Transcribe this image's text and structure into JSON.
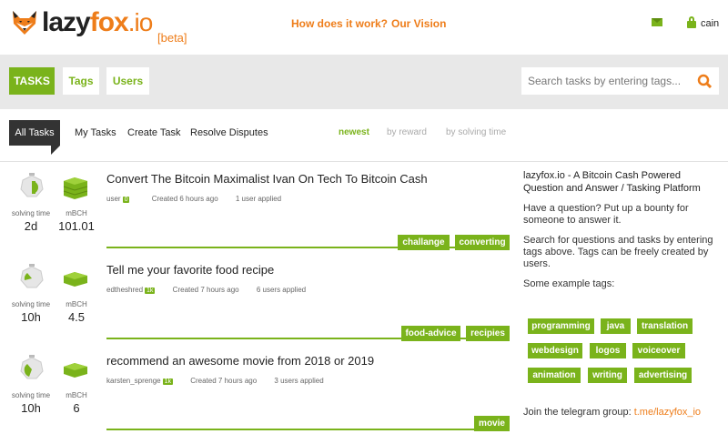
{
  "header": {
    "brand_prefix": "lazy",
    "brand_accent": "fox",
    "brand_io": ".io",
    "beta": "[beta]",
    "nav": [
      {
        "label": "How does it work?"
      },
      {
        "label": "Our Vision"
      }
    ],
    "user": "cain"
  },
  "toolbar": {
    "tabs": [
      {
        "label": "TASKS",
        "active": true
      },
      {
        "label": "Tags",
        "active": false
      },
      {
        "label": "Users",
        "active": false
      }
    ],
    "search_placeholder": "Search tasks by entering tags..."
  },
  "subnav": {
    "items": [
      "All Tasks",
      "My Tasks",
      "Create Task",
      "Resolve Disputes"
    ],
    "sort": [
      {
        "label": "newest",
        "active": true
      },
      {
        "label": "by reward",
        "active": false
      },
      {
        "label": "by solving time",
        "active": false
      }
    ]
  },
  "tasks": [
    {
      "solving_label": "solving time",
      "solving_value": "2d",
      "reward_label": "mBCH",
      "reward_value": "101.01",
      "title": "Convert The Bitcoin Maximalist Ivan On Tech To Bitcoin Cash",
      "user": "user",
      "rep": "0",
      "created": "Created 6 hours ago",
      "applied": "1 user applied",
      "tags": [
        "challange",
        "converting"
      ]
    },
    {
      "solving_label": "solving time",
      "solving_value": "10h",
      "reward_label": "mBCH",
      "reward_value": "4.5",
      "title": "Tell me your favorite food recipe",
      "user": "edtheshred",
      "rep": "1k",
      "created": "Created 7 hours ago",
      "applied": "6 users applied",
      "tags": [
        "food-advice",
        "recipies"
      ]
    },
    {
      "solving_label": "solving time",
      "solving_value": "10h",
      "reward_label": "mBCH",
      "reward_value": "6",
      "title": "recommend an awesome movie from 2018 or 2019",
      "user": "karsten_sprenge",
      "rep": "1k",
      "created": "Created 7 hours ago",
      "applied": "3 users applied",
      "tags": [
        "movie"
      ]
    }
  ],
  "panel": {
    "title_line1": "lazyfox.io - A Bitcoin Cash Powered",
    "title_line2": "Question and Answer / Tasking Platform",
    "p1": "Have a question? Put up a bounty for someone to answer it.",
    "p2": "Search for questions and tasks by entering tags above. Tags can be freely created by users.",
    "p3": "Some example tags:",
    "example_tags": [
      "programming",
      "java",
      "translation",
      "webdesign",
      "logos",
      "voiceover",
      "animation",
      "writing",
      "advertising"
    ],
    "telegram_text": "Join the telegram group: ",
    "telegram_link": "t.me/lazyfox_io"
  },
  "colors": {
    "accent_green": "#7ab31b",
    "accent_orange": "#ee7d1a",
    "band_gray": "#e8e8e8"
  }
}
